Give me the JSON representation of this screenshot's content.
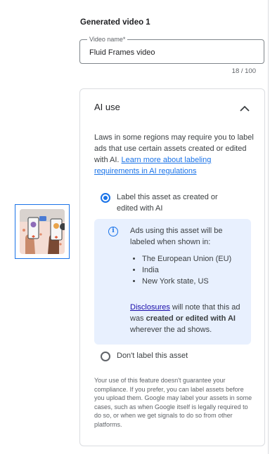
{
  "thumbnail": {
    "alt": "people-holding-phones-illustration"
  },
  "section": {
    "title": "Generated video 1"
  },
  "video_name": {
    "label": "Video name",
    "required_mark": "*",
    "value": "Fluid Frames video",
    "counter": "18 / 100"
  },
  "ai_card": {
    "title": "AI use",
    "intro_text": "Laws in some regions may require you to label ads that use certain assets created or edited with AI.",
    "intro_link": "Learn more about labeling requirements in AI regulations",
    "option_label": "Label this asset as created or edited with AI",
    "info": {
      "lead": "Ads using this asset will be labeled when shown in:",
      "regions": [
        "The European Union (EU)",
        "India",
        "New York state, US"
      ],
      "disclosures_link": "Disclosures",
      "note_before": " will note that this ad was ",
      "note_bold": "created or edited with AI",
      "note_after": " wherever the ad shows."
    },
    "option_no_label": "Don't label this asset",
    "footnote": "Your use of this feature doesn't guarantee your compliance. If you prefer, you can label assets before you upload them. Google may label your assets in some cases, such as when Google itself is legally required to do so, or when we get signals to do so from other platforms."
  },
  "colors": {
    "accent": "#1a73e8",
    "info_bg": "#e8f0fe",
    "thumb_bg": "#f4dcd3"
  }
}
